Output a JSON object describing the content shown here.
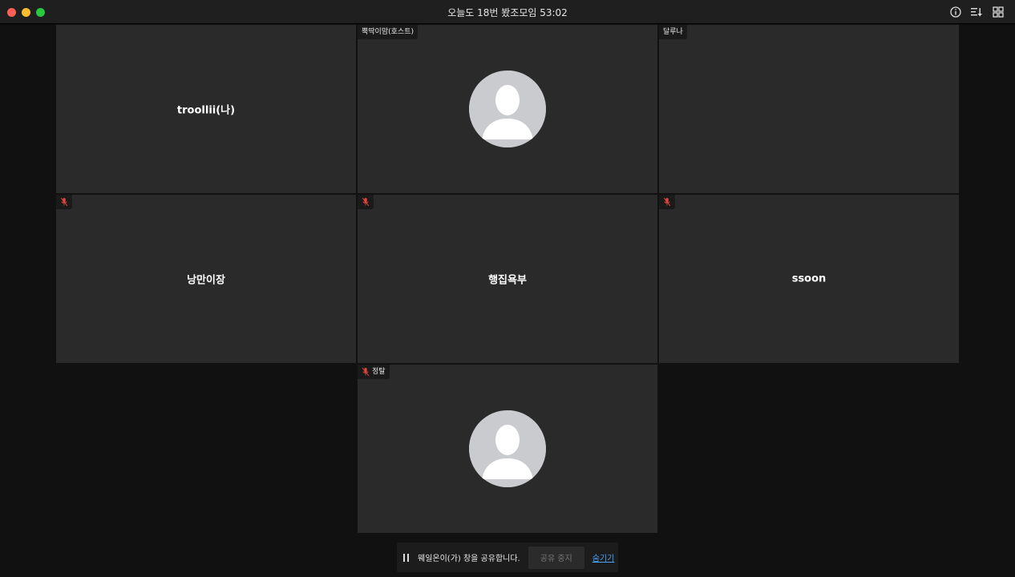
{
  "window": {
    "title": "오늘도 18번 봤조모임 53:02"
  },
  "toolbar": {
    "info_icon": "info-icon",
    "sort_icon": "sort-icon",
    "grid_icon": "grid-view-icon"
  },
  "participants": [
    {
      "name": "troollii(나)",
      "tag": "",
      "muted": false,
      "avatar": false,
      "show_center_name": true
    },
    {
      "name": "",
      "tag": "뿍딱이맘(호스트)",
      "muted": false,
      "avatar": true,
      "show_center_name": false
    },
    {
      "name": "",
      "tag": "달루나",
      "muted": false,
      "avatar": false,
      "show_center_name": false
    },
    {
      "name": "낭만이장",
      "tag": "",
      "muted": true,
      "avatar": false,
      "show_center_name": true
    },
    {
      "name": "행집욕부",
      "tag": "",
      "muted": true,
      "avatar": false,
      "show_center_name": true
    },
    {
      "name": "ssoon",
      "tag": "",
      "muted": true,
      "avatar": false,
      "show_center_name": true
    },
    {
      "name": "",
      "tag": "정탈",
      "muted": true,
      "avatar": true,
      "show_center_name": false
    }
  ],
  "share_bar": {
    "status_text": "웨일온이(가) 창을 공유합니다.",
    "stop_label": "공유 중지",
    "hide_label": "숨기기"
  },
  "colors": {
    "muted_mic": "#e0453a",
    "link": "#4aa3ff"
  }
}
